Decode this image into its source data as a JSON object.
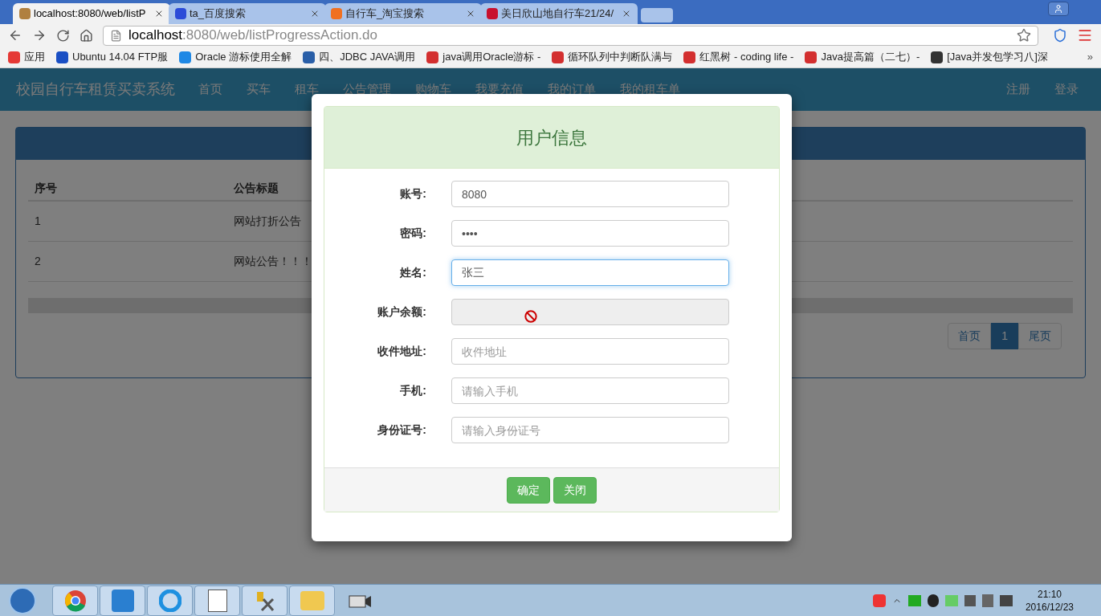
{
  "browser": {
    "tabs": [
      {
        "title": "localhost:8080/web/listP",
        "selected": true
      },
      {
        "title": "ta_百度搜索",
        "selected": false
      },
      {
        "title": "自行车_淘宝搜索",
        "selected": false
      },
      {
        "title": "美日欣山地自行车21/24/",
        "selected": false
      }
    ],
    "url_host": "localhost",
    "url_rest": ":8080/web/listProgressAction.do",
    "bookmarks": [
      "应用",
      "Ubuntu 14.04 FTP服",
      "Oracle 游标使用全解",
      "四、JDBC JAVA调用",
      "java调用Oracle游标 -",
      "循环队列中判断队满与",
      "红黑树 - coding life -",
      "Java提高篇（二七）-",
      "[Java并发包学习八]深"
    ],
    "more": "»"
  },
  "navbar": {
    "brand": "校园自行车租赁买卖系统",
    "items": [
      "首页",
      "买车",
      "租车",
      "公告管理",
      "购物车",
      "我要充值",
      "我的订单",
      "我的租车单"
    ],
    "right_items": [
      "注册",
      "登录"
    ]
  },
  "table": {
    "columns": [
      "序号",
      "公告标题"
    ],
    "rows": [
      [
        "1",
        "网站打折公告"
      ],
      [
        "2",
        "网站公告！！！"
      ]
    ]
  },
  "pagination": [
    {
      "label": "首页",
      "selected": false
    },
    {
      "label": "1",
      "selected": true
    },
    {
      "label": "尾页",
      "selected": false
    }
  ],
  "modal": {
    "title": "用户信息",
    "fields": [
      {
        "label": "账号:",
        "kind": "text",
        "value": "8080"
      },
      {
        "label": "密码:",
        "kind": "text",
        "value": "••••"
      },
      {
        "label": "姓名:",
        "kind": "focused",
        "value": "张三"
      },
      {
        "label": "账户余额:",
        "kind": "disabled"
      },
      {
        "label": "收件地址:",
        "kind": "text",
        "placeholder": "收件地址"
      },
      {
        "label": "手机:",
        "kind": "text",
        "placeholder": "请输入手机"
      },
      {
        "label": "身份证号:",
        "kind": "text",
        "placeholder": "请输入身份证号"
      }
    ],
    "buttons": [
      "确定",
      "关闭"
    ]
  },
  "taskbar": {
    "time": "21:10",
    "date": "2016/12/23"
  }
}
